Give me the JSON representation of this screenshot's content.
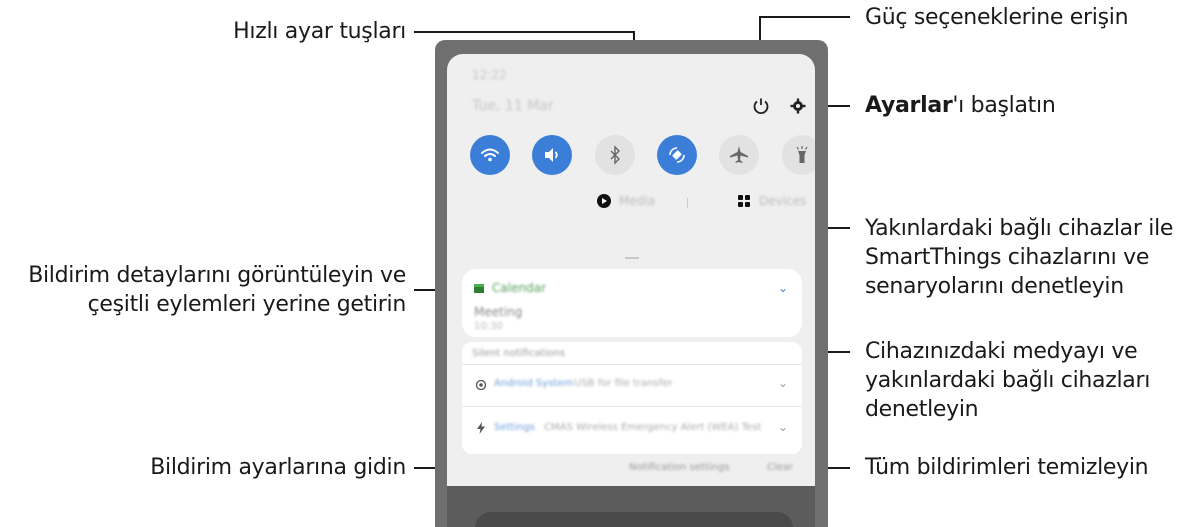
{
  "callouts": {
    "quick_settings": "Hızlı ayar tuşları",
    "power": "Güç seçeneklerine erişin",
    "settings_bold": "Ayarlar",
    "settings_rest": "'ı başlatın",
    "devices_line1": "Yakınlardaki bağlı cihazlar ile",
    "devices_line2": "SmartThings cihazlarını ve",
    "devices_line3": "senaryolarını denetleyin",
    "notif_details_line1": "Bildirim detaylarını görüntüleyin ve",
    "notif_details_line2": "çeşitli eylemleri yerine getirin",
    "media_line1": "Cihazınızdaki medyayı ve",
    "media_line2": "yakınlardaki bağlı cihazları",
    "media_line3": "denetleyin",
    "notif_settings": "Bildirim ayarlarına gidin",
    "clear_all": "Tüm bildirimleri temizleyin"
  },
  "screen": {
    "time": "12:22",
    "date": "Tue, 11 Mar",
    "media_label": "Media",
    "devices_label": "Devices",
    "calendar_app": "Calendar",
    "calendar_title": "Meeting",
    "calendar_time": "10:30",
    "silent_header": "Silent notifications",
    "notif1_app": "Android System",
    "notif1_text": "USB for file transfer",
    "notif2_app": "Settings",
    "notif2_text": "CMAS Wireless Emergency Alert (WEA) Test",
    "notif_settings_btn": "Notification settings",
    "clear_btn": "Clear"
  },
  "quick_settings": [
    {
      "name": "wifi",
      "state": "on",
      "icon": "wifi-icon"
    },
    {
      "name": "sound",
      "state": "on",
      "icon": "sound-icon"
    },
    {
      "name": "bluetooth",
      "state": "off",
      "icon": "bluetooth-icon"
    },
    {
      "name": "auto-rotate",
      "state": "on",
      "icon": "rotate-icon"
    },
    {
      "name": "airplane",
      "state": "off",
      "icon": "airplane-icon"
    },
    {
      "name": "flashlight",
      "state": "off",
      "icon": "flashlight-icon"
    }
  ],
  "colors": {
    "accent": "#3b7ed8",
    "panel": "#efefef",
    "line": "#1a1a1a"
  }
}
